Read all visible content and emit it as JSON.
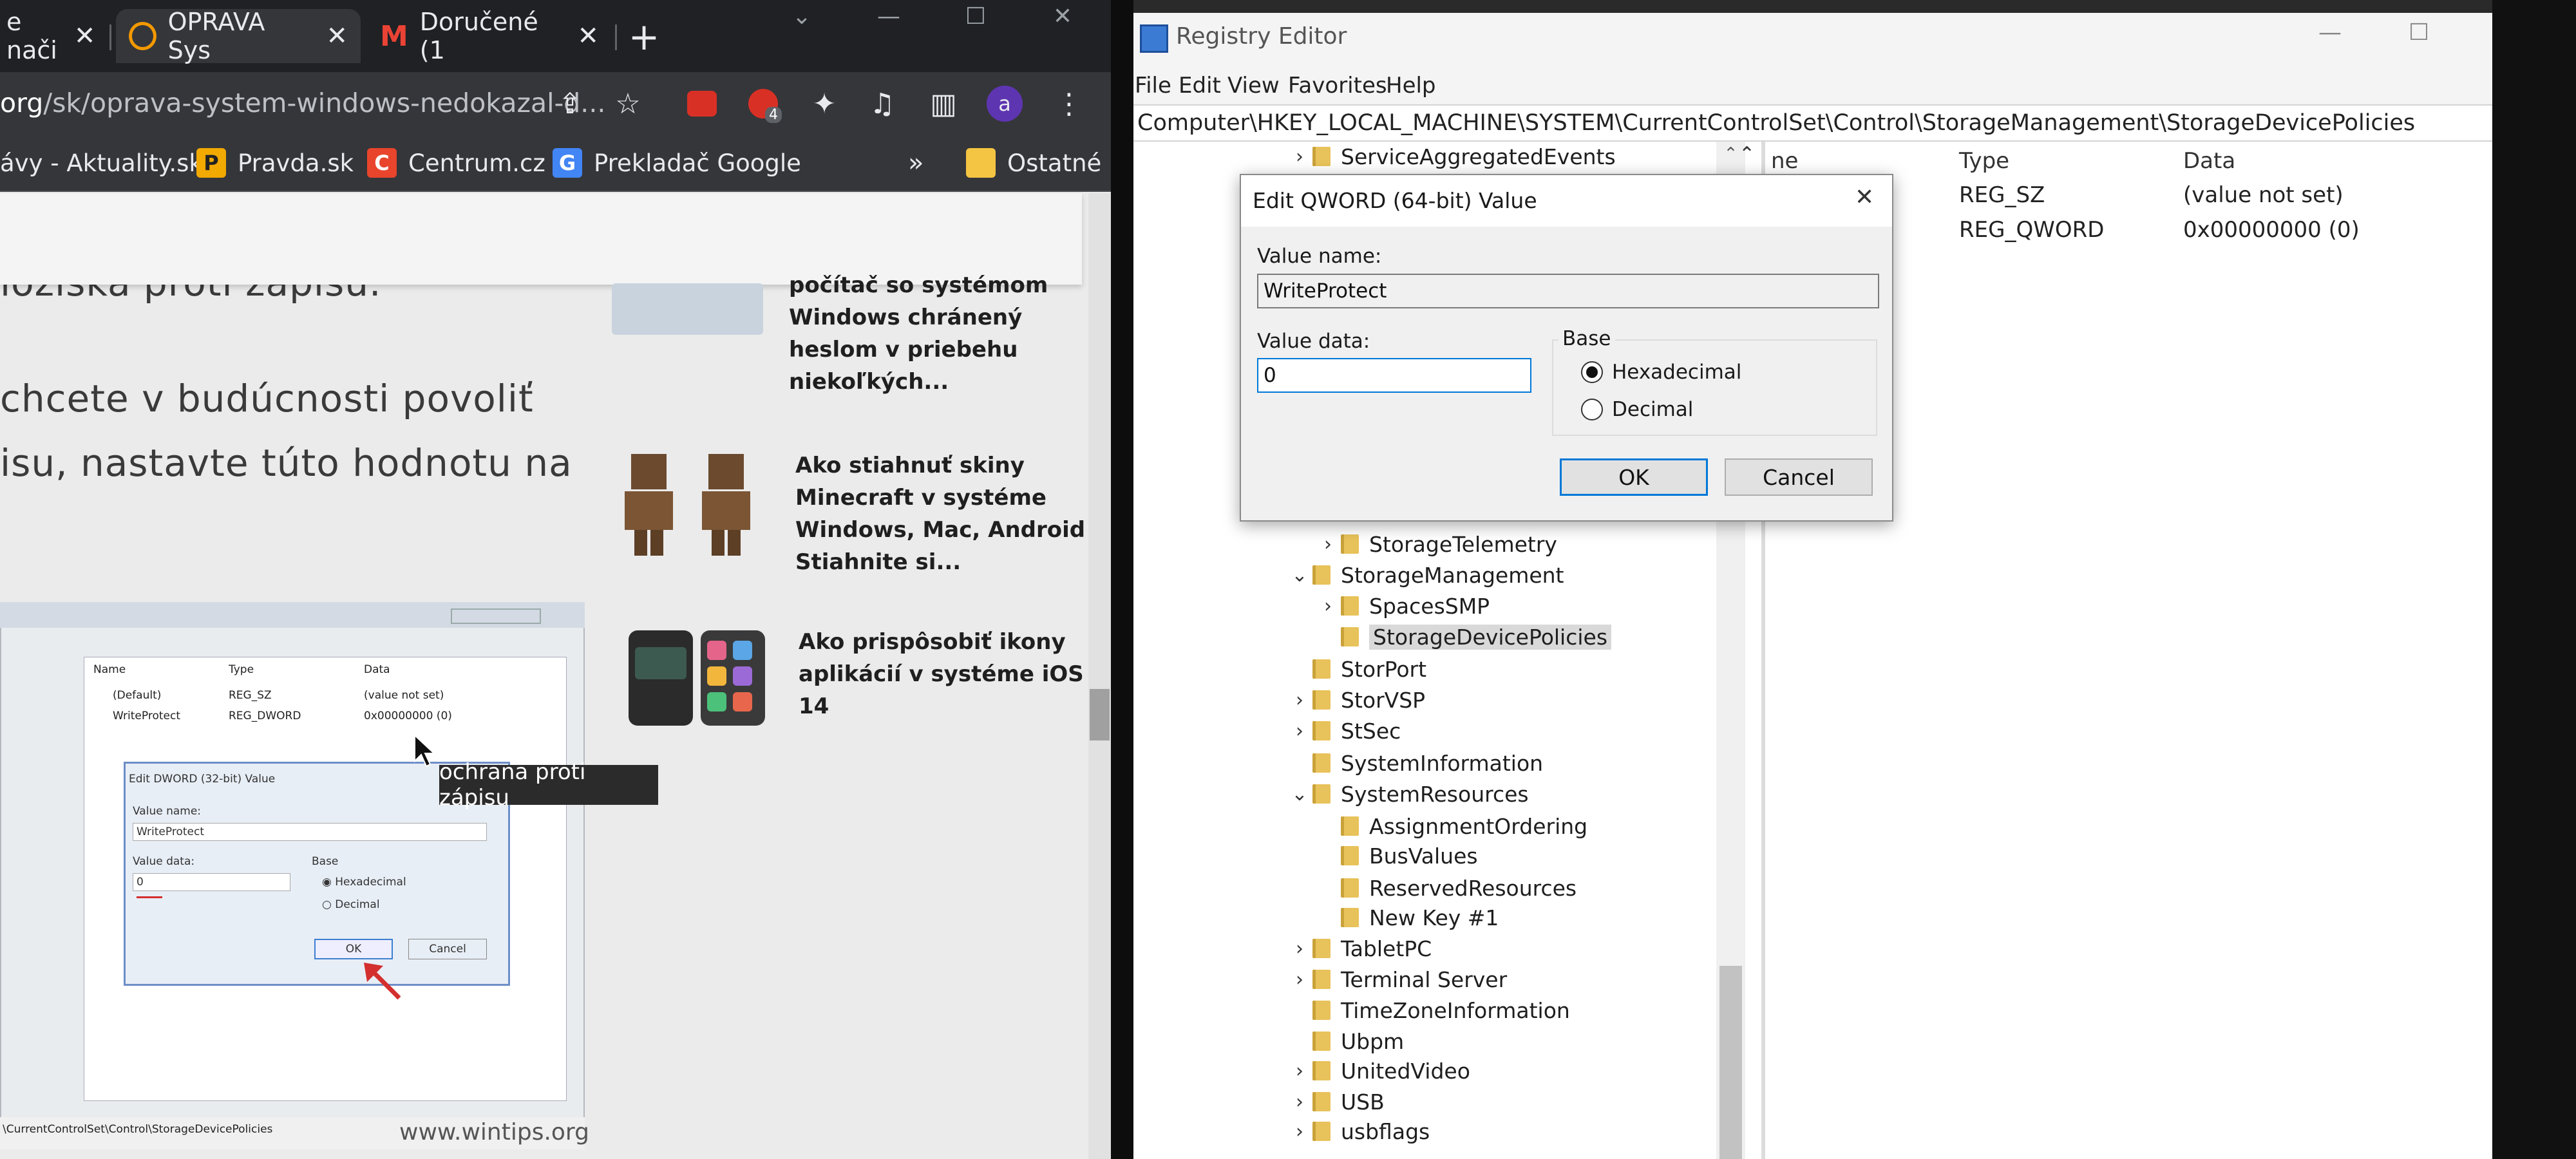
{
  "chrome": {
    "tabs": [
      {
        "title": "e nači"
      },
      {
        "title": "OPRAVA Sys"
      },
      {
        "title": "Doručené (1"
      }
    ],
    "url_host": "org",
    "url_path": "/sk/oprava-system-windows-nedokazal-d...",
    "profile_initial": "a",
    "extension_badge": "4",
    "bookmarks": [
      {
        "label": "ávy - Aktuality.sk",
        "icon": ""
      },
      {
        "label": "Pravda.sk",
        "icon": "P"
      },
      {
        "label": "Centrum.cz",
        "icon": "C"
      },
      {
        "label": "Prekladač Google",
        "icon": "G"
      },
      {
        "label": "Ostatné",
        "icon": ""
      }
    ],
    "bookmarks_more": "»"
  },
  "article": {
    "lines": [
      "loziska proti zápisu.",
      "chcete v budúcnosti povoliť",
      "isu, nastavte túto hodnotu na"
    ],
    "sidebar": [
      {
        "title_lines": [
          "počítač so systémom",
          "Windows chránený",
          "heslom v priebehu",
          "niekoľkých..."
        ]
      },
      {
        "title_lines": [
          "Ako stiahnuť skiny",
          "Minecraft v systéme",
          "Windows, Mac, Android",
          "Stiahnite si..."
        ]
      },
      {
        "title_lines": [
          "Ako prispôsobiť ikony",
          "aplikácií v systéme iOS",
          "14"
        ]
      }
    ]
  },
  "embedded_shot": {
    "columns": [
      "Name",
      "Type",
      "Data"
    ],
    "rows": [
      {
        "name": "(Default)",
        "type": "REG_SZ",
        "data": "(value not set)"
      },
      {
        "name": "WriteProtect",
        "type": "REG_DWORD",
        "data": "0x00000000 (0)"
      }
    ],
    "dialog_title": "Edit DWORD (32-bit) Value",
    "value_name_label": "Value name:",
    "value_name": "WriteProtect",
    "value_data_label": "Value data:",
    "value_data": "0",
    "base_label": "Base",
    "hex_label": "Hexadecimal",
    "dec_label": "Decimal",
    "ok": "OK",
    "cancel": "Cancel",
    "path": "\\CurrentControlSet\\Control\\StorageDevicePolicies",
    "watermark": "www.wintips.org"
  },
  "tooltip": "ochrana proti zápisu",
  "regedit": {
    "title": "Registry Editor",
    "menu": [
      "File",
      "Edit",
      "View",
      "Favorites",
      "Help"
    ],
    "address": "Computer\\HKEY_LOCAL_MACHINE\\SYSTEM\\CurrentControlSet\\Control\\StorageManagement\\StorageDevicePolicies",
    "columns": {
      "name": "ne",
      "type": "Type",
      "data": "Data"
    },
    "values": [
      {
        "type": "REG_SZ",
        "data": "(value not set)"
      },
      {
        "type": "REG_QWORD",
        "data": "0x00000000 (0)"
      }
    ],
    "tree": [
      {
        "label": "ServiceAggregatedEvents",
        "indent": 0,
        "chev": "›"
      },
      {
        "label": "StorageTelemetry",
        "indent": 1,
        "chev": "›"
      },
      {
        "label": "StorageManagement",
        "indent": 0,
        "chev": "⌄"
      },
      {
        "label": "SpacesSMP",
        "indent": 1,
        "chev": "›"
      },
      {
        "label": "StorageDevicePolicies",
        "indent": 1,
        "chev": "",
        "selected": true
      },
      {
        "label": "StorPort",
        "indent": 0,
        "chev": ""
      },
      {
        "label": "StorVSP",
        "indent": 0,
        "chev": "›"
      },
      {
        "label": "StSec",
        "indent": 0,
        "chev": "›"
      },
      {
        "label": "SystemInformation",
        "indent": 0,
        "chev": ""
      },
      {
        "label": "SystemResources",
        "indent": 0,
        "chev": "⌄"
      },
      {
        "label": "AssignmentOrdering",
        "indent": 1,
        "chev": ""
      },
      {
        "label": "BusValues",
        "indent": 1,
        "chev": ""
      },
      {
        "label": "ReservedResources",
        "indent": 1,
        "chev": ""
      },
      {
        "label": "New Key #1",
        "indent": 1,
        "chev": ""
      },
      {
        "label": "TabletPC",
        "indent": 0,
        "chev": "›"
      },
      {
        "label": "Terminal Server",
        "indent": 0,
        "chev": "›"
      },
      {
        "label": "TimeZoneInformation",
        "indent": 0,
        "chev": ""
      },
      {
        "label": "Ubpm",
        "indent": 0,
        "chev": ""
      },
      {
        "label": "UnitedVideo",
        "indent": 0,
        "chev": "›"
      },
      {
        "label": "USB",
        "indent": 0,
        "chev": "›"
      },
      {
        "label": "usbflags",
        "indent": 0,
        "chev": "›"
      }
    ],
    "dialog": {
      "title": "Edit QWORD (64-bit) Value",
      "value_name_label": "Value name:",
      "value_name": "WriteProtect",
      "value_data_label": "Value data:",
      "value_data": "0",
      "base_label": "Base",
      "hex_label": "Hexadecimal",
      "dec_label": "Decimal",
      "base_selected": "Hexadecimal",
      "ok": "OK",
      "cancel": "Cancel"
    }
  }
}
